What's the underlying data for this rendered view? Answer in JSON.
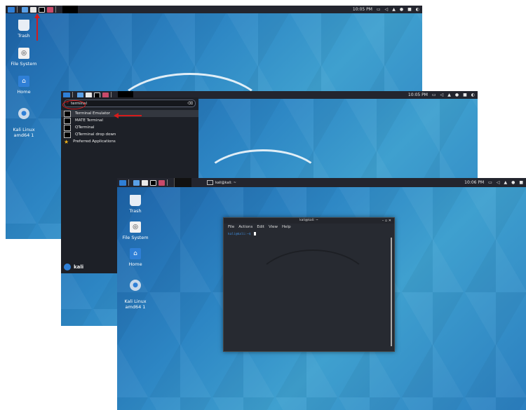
{
  "shot1": {
    "clock": "10:05 PM",
    "desktop_icons": [
      {
        "label": "Trash"
      },
      {
        "label": "File System"
      },
      {
        "label": "Home"
      },
      {
        "label": "Kali Linux\namd64 1"
      }
    ]
  },
  "shot2": {
    "clock": "10:05 PM",
    "search_value": "terminal",
    "results": [
      {
        "label": "Terminal Emulator"
      },
      {
        "label": "MATE Terminal"
      },
      {
        "label": "QTerminal"
      },
      {
        "label": "QTerminal drop down"
      },
      {
        "label": "Preferred Applications"
      }
    ],
    "user_label": "kali"
  },
  "shot3": {
    "clock": "10:06 PM",
    "taskbar_window": "kali@kali: ~",
    "desktop_icons": [
      {
        "label": "Trash"
      },
      {
        "label": "File System"
      },
      {
        "label": "Home"
      },
      {
        "label": "Kali Linux\namd64 1"
      }
    ],
    "terminal": {
      "title": "kali@kali: ~",
      "menu": [
        "File",
        "Actions",
        "Edit",
        "View",
        "Help"
      ],
      "prompt": "kali@kali:~$"
    }
  },
  "colors": {
    "panel": "#23252e",
    "accent_blue": "#2f7fd6",
    "annotation_red": "#d51b1b"
  }
}
